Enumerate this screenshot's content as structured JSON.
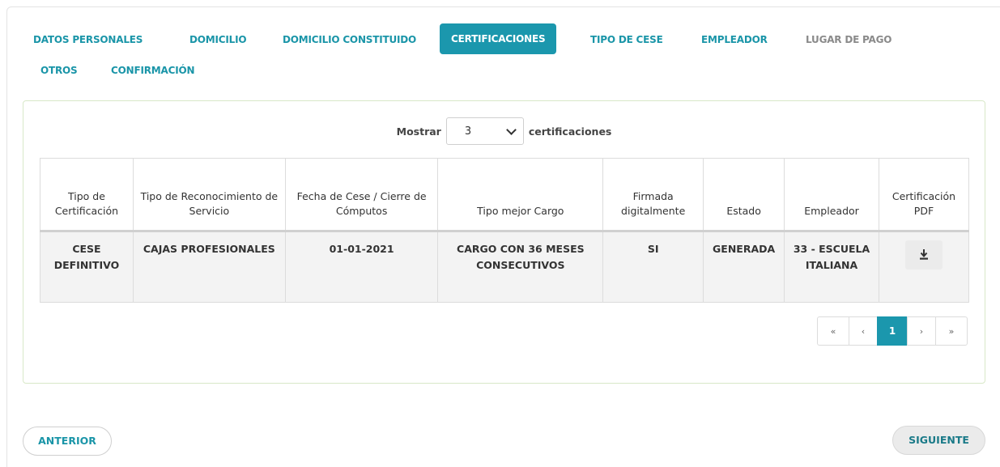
{
  "tabs": [
    {
      "label": "DATOS PERSONALES"
    },
    {
      "label": "DOMICILIO"
    },
    {
      "label": "DOMICILIO CONSTITUIDO"
    },
    {
      "label": "CERTIFICACIONES"
    },
    {
      "label": "TIPO DE CESE"
    },
    {
      "label": "EMPLEADOR"
    },
    {
      "label": "LUGAR DE PAGO"
    },
    {
      "label": "OTROS"
    },
    {
      "label": "CONFIRMACIÓN"
    }
  ],
  "active_tab": "CERTIFICACIONES",
  "show": {
    "prefix": "Mostrar",
    "selected": "3",
    "suffix": "certificaciones"
  },
  "table": {
    "headers": [
      "Tipo de Certificación",
      "Tipo de Reconocimiento de Servicio",
      "Fecha de Cese / Cierre de Cómputos",
      "Tipo mejor Cargo",
      "Firmada digitalmente",
      "Estado",
      "Empleador",
      "Certificación PDF"
    ],
    "rows": [
      {
        "tipo_certificacion": "CESE DEFINITIVO",
        "tipo_reconocimiento": "CAJAS PROFESIONALES",
        "fecha_cese": "01-01-2021",
        "tipo_mejor_cargo": "CARGO CON 36 MESES CONSECUTIVOS",
        "firmada": "SI",
        "estado": "GENERADA",
        "empleador": "33 - ESCUELA ITALIANA",
        "pdf_icon": "download-icon"
      }
    ]
  },
  "pagination": {
    "first": "«",
    "prev": "‹",
    "current": "1",
    "next": "›",
    "last": "»"
  },
  "buttons": {
    "previous": "ANTERIOR",
    "next": "SIGUIENTE"
  },
  "colors": {
    "accent": "#1b97ad",
    "link": "#1a95a8",
    "muted": "#8a8a8a",
    "row_bg": "#f3f3f3"
  }
}
